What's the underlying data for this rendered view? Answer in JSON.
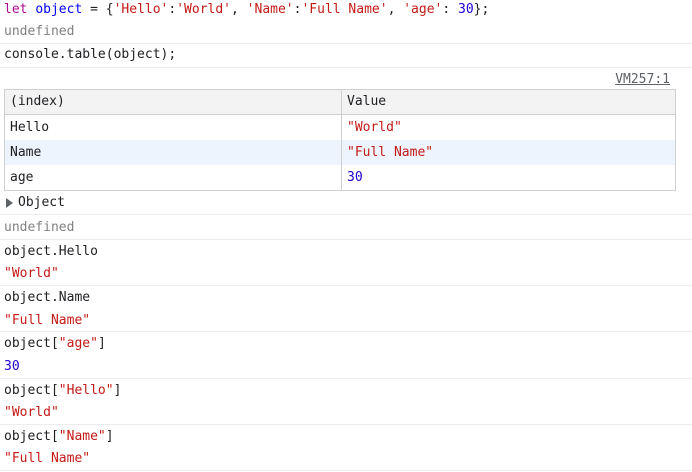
{
  "console": {
    "line1": {
      "kw": "let",
      "ident": "object",
      "eq": " = {",
      "k1": "'Hello'",
      "c1": ":",
      "v1": "'World'",
      "sep1": ", ",
      "k2": "'Name'",
      "c2": ":",
      "v2": "'Full Name'",
      "sep2": ", ",
      "k3": "'age'",
      "c3": ": ",
      "v3": "30",
      "end": "};"
    },
    "undefined1": "undefined",
    "cmd_table": "console.table(object);",
    "vm_link": "VM257:1",
    "table": {
      "headers": [
        "(index)",
        "Value"
      ],
      "rows": [
        {
          "index": "Hello",
          "value": "\"World\""
        },
        {
          "index": "Name",
          "value": "\"Full Name\""
        },
        {
          "index": "age",
          "value": "30"
        }
      ]
    },
    "object_label": "Object",
    "undefined2": "undefined",
    "expr_hello": "object.Hello",
    "res_hello": "\"World\"",
    "expr_name": "object.Name",
    "res_name": "\"Full Name\"",
    "expr_age_prefix": "object[",
    "expr_age_key": "\"age\"",
    "expr_age_suffix": "]",
    "res_age": "30",
    "expr_hello2_prefix": "object[",
    "expr_hello2_key": "\"Hello\"",
    "expr_hello2_suffix": "]",
    "res_hello2": "\"World\"",
    "expr_name2_prefix": "object[",
    "expr_name2_key": "\"Name\"",
    "expr_name2_suffix": "]",
    "res_name2": "\"Full Name\""
  },
  "icons": {
    "expand": "triangle-right-icon"
  },
  "colors": {
    "keyword": "#aa0d91",
    "string": "#c41a16",
    "number": "#1c00cf",
    "muted": "#808080",
    "table_border": "#cfcfcf",
    "row_highlight": "#eef4fd"
  }
}
